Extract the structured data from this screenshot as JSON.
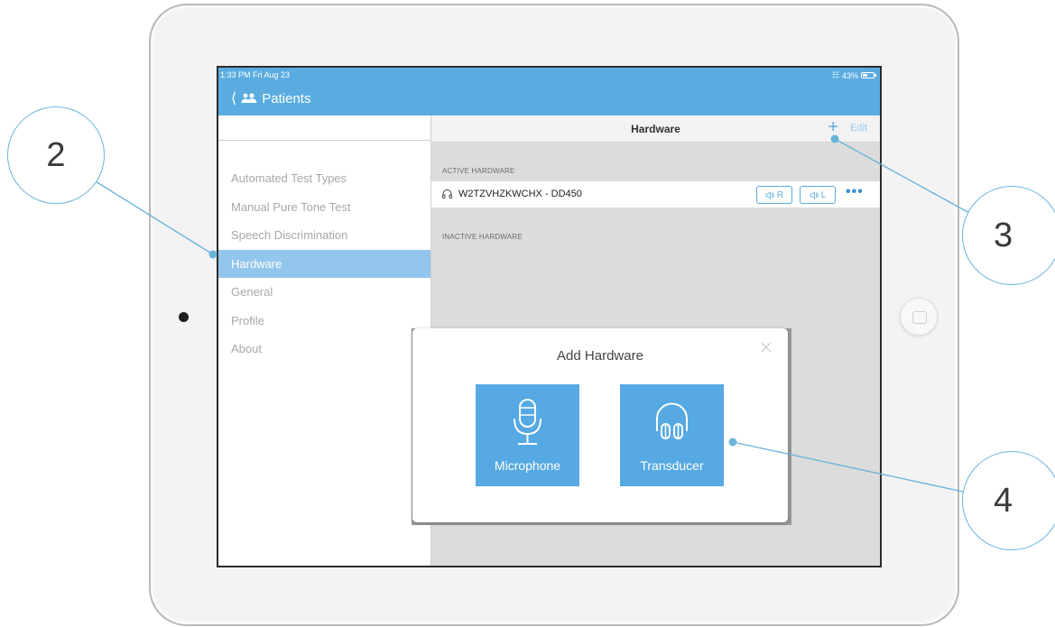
{
  "status_bar": {
    "time": "1:33 PM  Fri Aug 23",
    "battery": "43%"
  },
  "nav": {
    "back_label": "Patients"
  },
  "sidebar": {
    "items": [
      {
        "label": "Automated Test Types"
      },
      {
        "label": "Manual Pure Tone Test"
      },
      {
        "label": "Speech Discrimination"
      },
      {
        "label": "Hardware"
      },
      {
        "label": "General"
      },
      {
        "label": "Profile"
      },
      {
        "label": "About"
      }
    ]
  },
  "main": {
    "title": "Hardware",
    "add_label": "+",
    "edit_label": "Edit",
    "active_section": "ACTIVE HARDWARE",
    "inactive_section": "INACTIVE HARDWARE",
    "active_device": {
      "name": "W2TZVHZKWCHX - DD450",
      "right_label": "R",
      "left_label": "L",
      "more_label": "•••"
    }
  },
  "modal": {
    "title": "Add Hardware",
    "options": [
      {
        "label": "Microphone",
        "icon": "microphone-icon"
      },
      {
        "label": "Transducer",
        "icon": "headphones-icon"
      }
    ]
  },
  "callouts": {
    "c2": "2",
    "c3": "3",
    "c4": "4"
  },
  "colors": {
    "accent": "#5aace0",
    "sidebar_active": "#93c6ec",
    "callout_stroke": "#6ab4dc"
  }
}
